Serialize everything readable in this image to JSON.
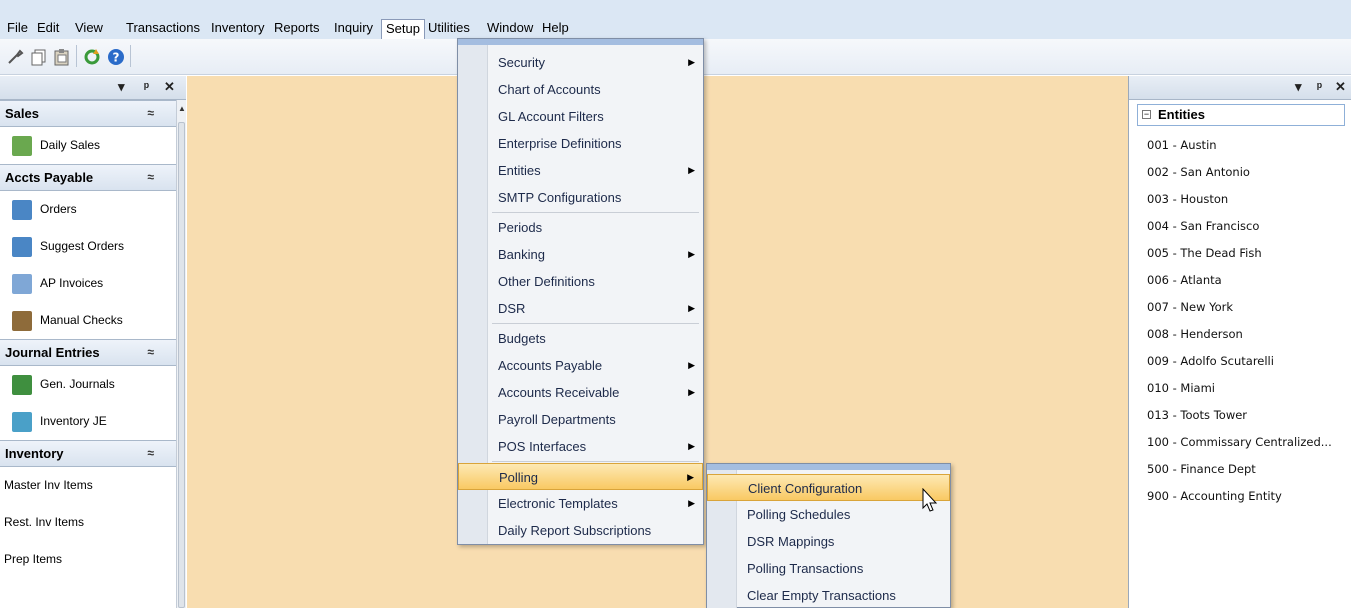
{
  "menubar": {
    "items": [
      "File",
      "Edit",
      "View",
      "Transactions",
      "Inventory",
      "Reports",
      "Inquiry",
      "Setup",
      "Utilities",
      "Window",
      "Help"
    ],
    "active": "Setup"
  },
  "toolbar": {
    "icons": [
      "wrench-icon",
      "copy-icon",
      "paste-icon",
      "refresh-icon",
      "help-icon"
    ]
  },
  "left_panel": {
    "controls": [
      "▾",
      "ᵖ",
      "✕"
    ],
    "sections": [
      {
        "title": "Sales",
        "items": [
          {
            "label": "Daily Sales",
            "icon": "daily-sales-icon",
            "color": "#6aa84f"
          }
        ]
      },
      {
        "title": "Accts Payable",
        "items": [
          {
            "label": "Orders",
            "icon": "orders-icon",
            "color": "#4a86c5"
          },
          {
            "label": "Suggest Orders",
            "icon": "suggest-orders-icon",
            "color": "#4a86c5"
          },
          {
            "label": "AP Invoices",
            "icon": "ap-invoices-icon",
            "color": "#7fa7d6"
          },
          {
            "label": "Manual Checks",
            "icon": "manual-checks-icon",
            "color": "#8e6b3a"
          }
        ]
      },
      {
        "title": "Journal Entries",
        "items": [
          {
            "label": "Gen. Journals",
            "icon": "gen-journals-icon",
            "color": "#3f8f3f"
          },
          {
            "label": "Inventory JE",
            "icon": "inventory-je-icon",
            "color": "#4aa0c8"
          }
        ]
      },
      {
        "title": "Inventory",
        "items": [
          {
            "label": "Master Inv Items"
          },
          {
            "label": "Rest. Inv Items"
          },
          {
            "label": "Prep Items"
          }
        ]
      }
    ],
    "chevron": "≈"
  },
  "setup_menu": {
    "items": [
      {
        "label": "Security",
        "submenu": true
      },
      {
        "label": "Chart of Accounts",
        "submenu": false
      },
      {
        "label": "GL Account Filters",
        "submenu": false
      },
      {
        "label": "Enterprise Definitions",
        "submenu": false
      },
      {
        "label": "Entities",
        "submenu": true
      },
      {
        "label": "SMTP Configurations",
        "submenu": false,
        "sep_after": true
      },
      {
        "label": "Periods",
        "submenu": false
      },
      {
        "label": "Banking",
        "submenu": true
      },
      {
        "label": "Other Definitions",
        "submenu": false
      },
      {
        "label": "DSR",
        "submenu": true,
        "sep_after": true
      },
      {
        "label": "Budgets",
        "submenu": false
      },
      {
        "label": "Accounts Payable",
        "submenu": true
      },
      {
        "label": "Accounts Receivable",
        "submenu": true
      },
      {
        "label": "Payroll Departments",
        "submenu": false
      },
      {
        "label": "POS Interfaces",
        "submenu": true,
        "sep_after": true
      },
      {
        "label": "Polling",
        "submenu": true,
        "highlight": true
      },
      {
        "label": "Electronic Templates",
        "submenu": true
      },
      {
        "label": "Daily Report Subscriptions",
        "submenu": false
      }
    ]
  },
  "polling_menu": {
    "items": [
      {
        "label": "Client Configuration",
        "highlight": true
      },
      {
        "label": "Polling Schedules"
      },
      {
        "label": "DSR Mappings"
      },
      {
        "label": "Polling Transactions"
      },
      {
        "label": "Clear Empty Transactions"
      }
    ]
  },
  "right_panel": {
    "controls": [
      "▾",
      "ᵖ",
      "✕"
    ],
    "header": "Entities",
    "entities": [
      "001 - Austin",
      "002 - San Antonio",
      "003 - Houston",
      "004 - San Francisco",
      "005 - The Dead Fish",
      "006 - Atlanta",
      "007 - New York",
      "008 - Henderson",
      "009 - Adolfo Scutarelli",
      "010 - Miami",
      "013 - Toots Tower",
      "100 - Commissary Centralized...",
      "500 - Finance Dept",
      "900 - Accounting Entity"
    ]
  },
  "colors": {
    "workspace": "#f8ddb0",
    "menubar": "#dbe7f4",
    "highlight": "#f9c963"
  }
}
